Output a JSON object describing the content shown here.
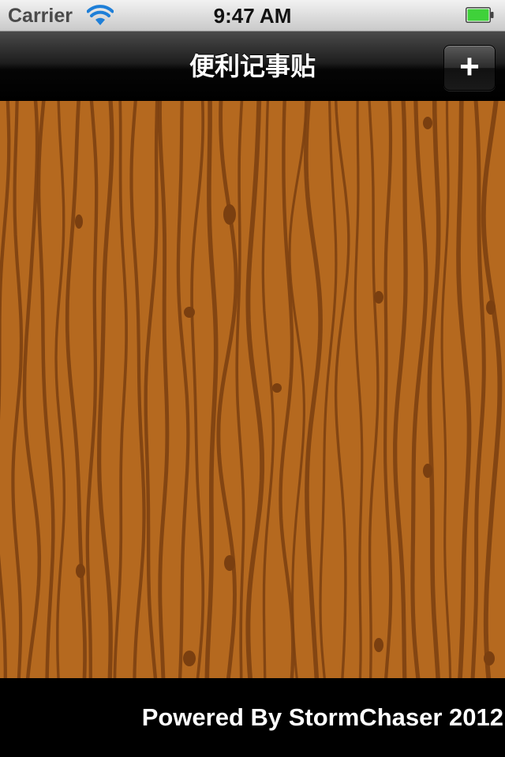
{
  "status_bar": {
    "carrier": "Carrier",
    "time": "9:47 AM",
    "wifi_icon": "wifi-icon",
    "battery_icon": "battery-icon",
    "battery_level": 1.0,
    "battery_color": "#3fd13a"
  },
  "nav_bar": {
    "title": "便利记事贴",
    "add_label": "+"
  },
  "content": {
    "background_color": "#b5691f",
    "grain_color": "#7a3f10"
  },
  "footer": {
    "text": "Powered By StormChaser 2012"
  }
}
